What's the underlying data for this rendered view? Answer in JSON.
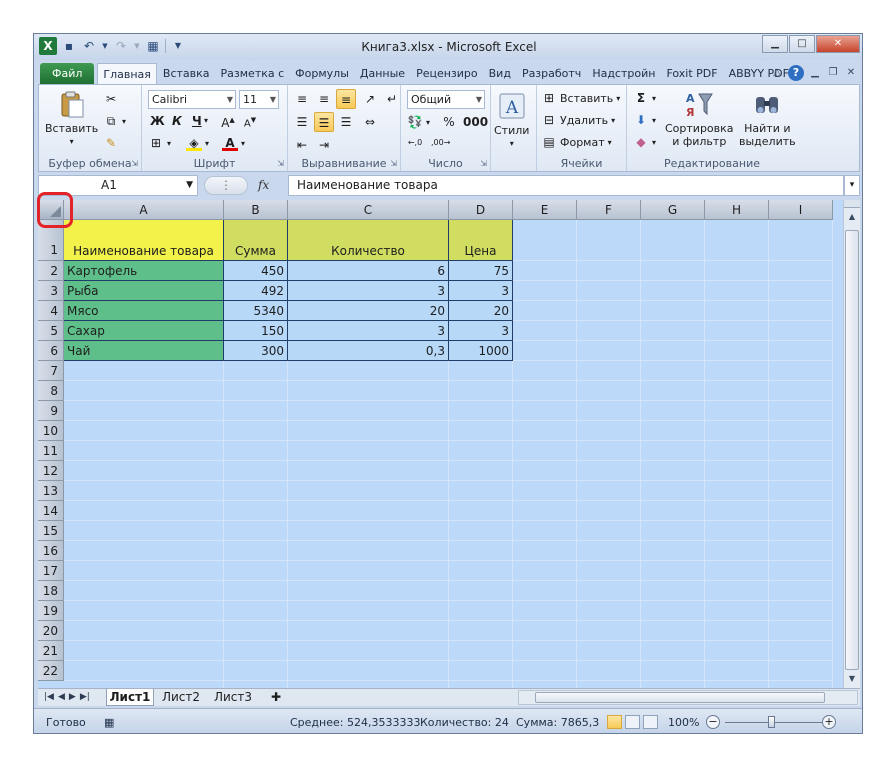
{
  "window": {
    "title": "Книга3.xlsx - Microsoft Excel"
  },
  "ribbon_tabs": [
    "Главная",
    "Вставка",
    "Разметка с",
    "Формулы",
    "Данные",
    "Рецензиро",
    "Вид",
    "Разработч",
    "Надстройн",
    "Foxit PDF",
    "ABBYY PDF"
  ],
  "file_tab": "Файл",
  "groups": {
    "clipboard": {
      "label": "Буфер обмена",
      "paste": "Вставить"
    },
    "font": {
      "label": "Шрифт",
      "font_name": "Calibri",
      "font_size": "11",
      "bold": "Ж",
      "italic": "К",
      "underline": "Ч"
    },
    "alignment": {
      "label": "Выравнивание"
    },
    "number": {
      "label": "Число",
      "format": "Общий"
    },
    "styles": {
      "label": "Стили"
    },
    "cells": {
      "label": "Ячейки",
      "insert": "Вставить",
      "delete": "Удалить",
      "format": "Формат"
    },
    "editing": {
      "label": "Редактирование",
      "sort1": "Сортировка",
      "sort2": "и фильтр",
      "find1": "Найти и",
      "find2": "выделить"
    }
  },
  "formula_bar": {
    "name_box": "A1",
    "fx": "fx",
    "content": "Наименование товара"
  },
  "columns": [
    "A",
    "B",
    "C",
    "D",
    "E",
    "F",
    "G",
    "H",
    "I"
  ],
  "rows": [
    "1",
    "2",
    "3",
    "4",
    "5",
    "6",
    "7",
    "8",
    "9",
    "10",
    "11",
    "12",
    "13",
    "14",
    "15",
    "16",
    "17",
    "18",
    "19",
    "20",
    "21",
    "22"
  ],
  "table": {
    "headers": [
      "Наименование товара",
      "Сумма",
      "Количество",
      "Цена"
    ],
    "rows": [
      [
        "Картофель",
        "450",
        "6",
        "75"
      ],
      [
        "Рыба",
        "492",
        "3",
        "3"
      ],
      [
        "Мясо",
        "5340",
        "20",
        "20"
      ],
      [
        "Сахар",
        "150",
        "3",
        "3"
      ],
      [
        "Чай",
        "300",
        "0,3",
        "1000"
      ]
    ]
  },
  "sheet_tabs": [
    "Лист1",
    "Лист2",
    "Лист3"
  ],
  "status": {
    "ready": "Готово",
    "average": "Среднее: 524,3533333",
    "count": "Количество: 24",
    "sum": "Сумма: 7865,3",
    "zoom": "100%"
  },
  "colors": {
    "header_a": "#f2f24a",
    "header_other": "#d0dd60",
    "names_fill": "#5fbf8a",
    "selection": "#bcd9f9",
    "highlight": "#e2242a"
  }
}
